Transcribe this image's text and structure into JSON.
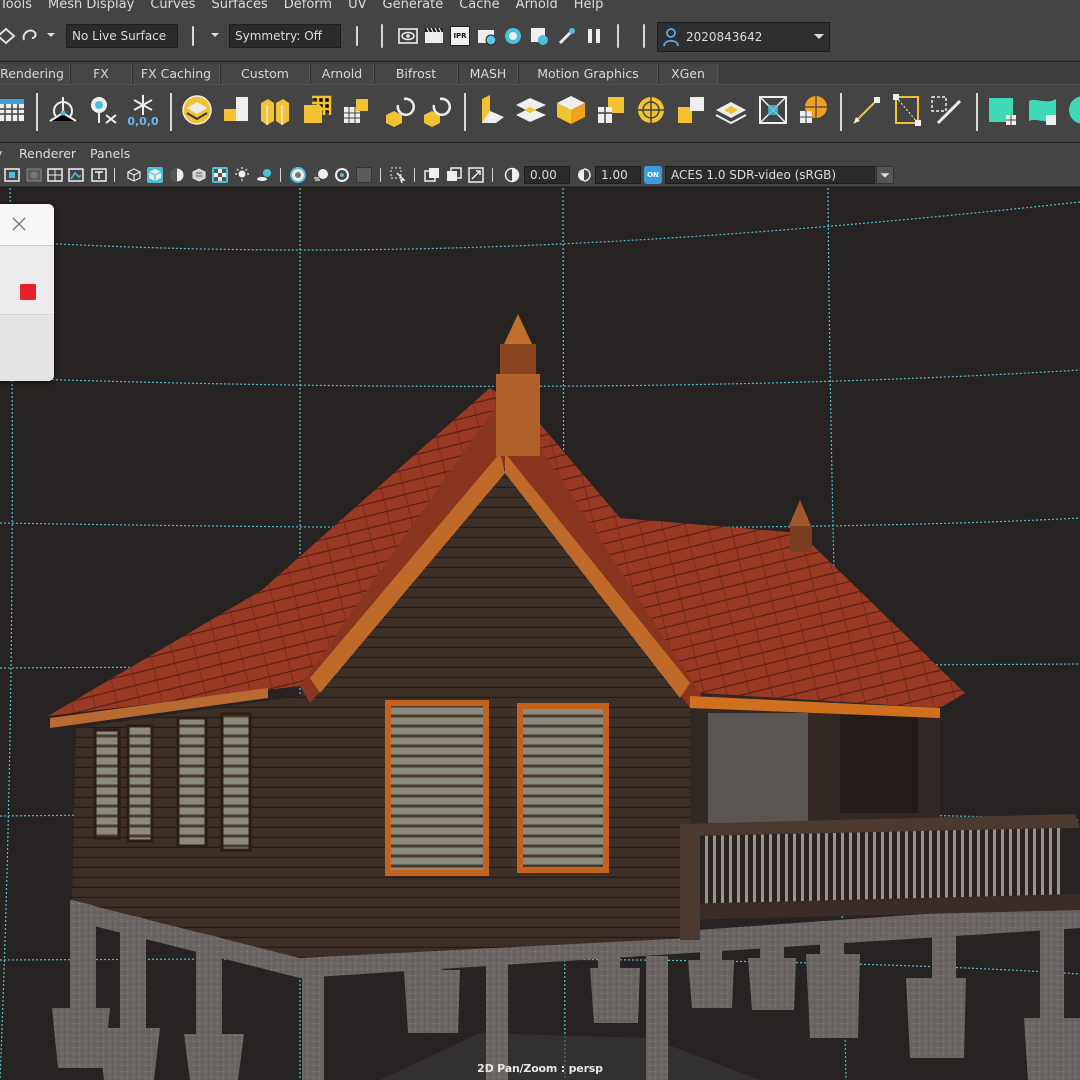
{
  "menubar": {
    "items": [
      "Tools",
      "Mesh Display",
      "Curves",
      "Surfaces",
      "Deform",
      "UV",
      "Generate",
      "Cache",
      "Arnold",
      "Help"
    ]
  },
  "statusline": {
    "live_surface": "No Live Surface",
    "symmetry": "Symmetry: Off",
    "ipr_label": "IPR",
    "user_id": "2020843642"
  },
  "shelf_tabs": [
    "Rendering",
    "FX",
    "FX Caching",
    "Custom",
    "Arnold",
    "Bifrost",
    "MASH",
    "Motion Graphics",
    "XGen"
  ],
  "shelf": {
    "snap_label": "0,0,0"
  },
  "panel_menu": [
    "Renderer",
    "Panels"
  ],
  "panel_toolbar": {
    "exposure": "0.00",
    "gamma": "1.00",
    "color_space": "ACES 1.0 SDR-video (sRGB)",
    "cm_badge": "ON"
  },
  "viewport": {
    "camera_label": "2D Pan/Zoom : persp"
  },
  "colors": {
    "ui_bg": "#444444",
    "viewport_bg": "#272322",
    "grid": "#52d0e0",
    "accent_teal": "#3fd9b8",
    "accent_yellow": "#f2c230",
    "record_red": "#e8202a"
  }
}
